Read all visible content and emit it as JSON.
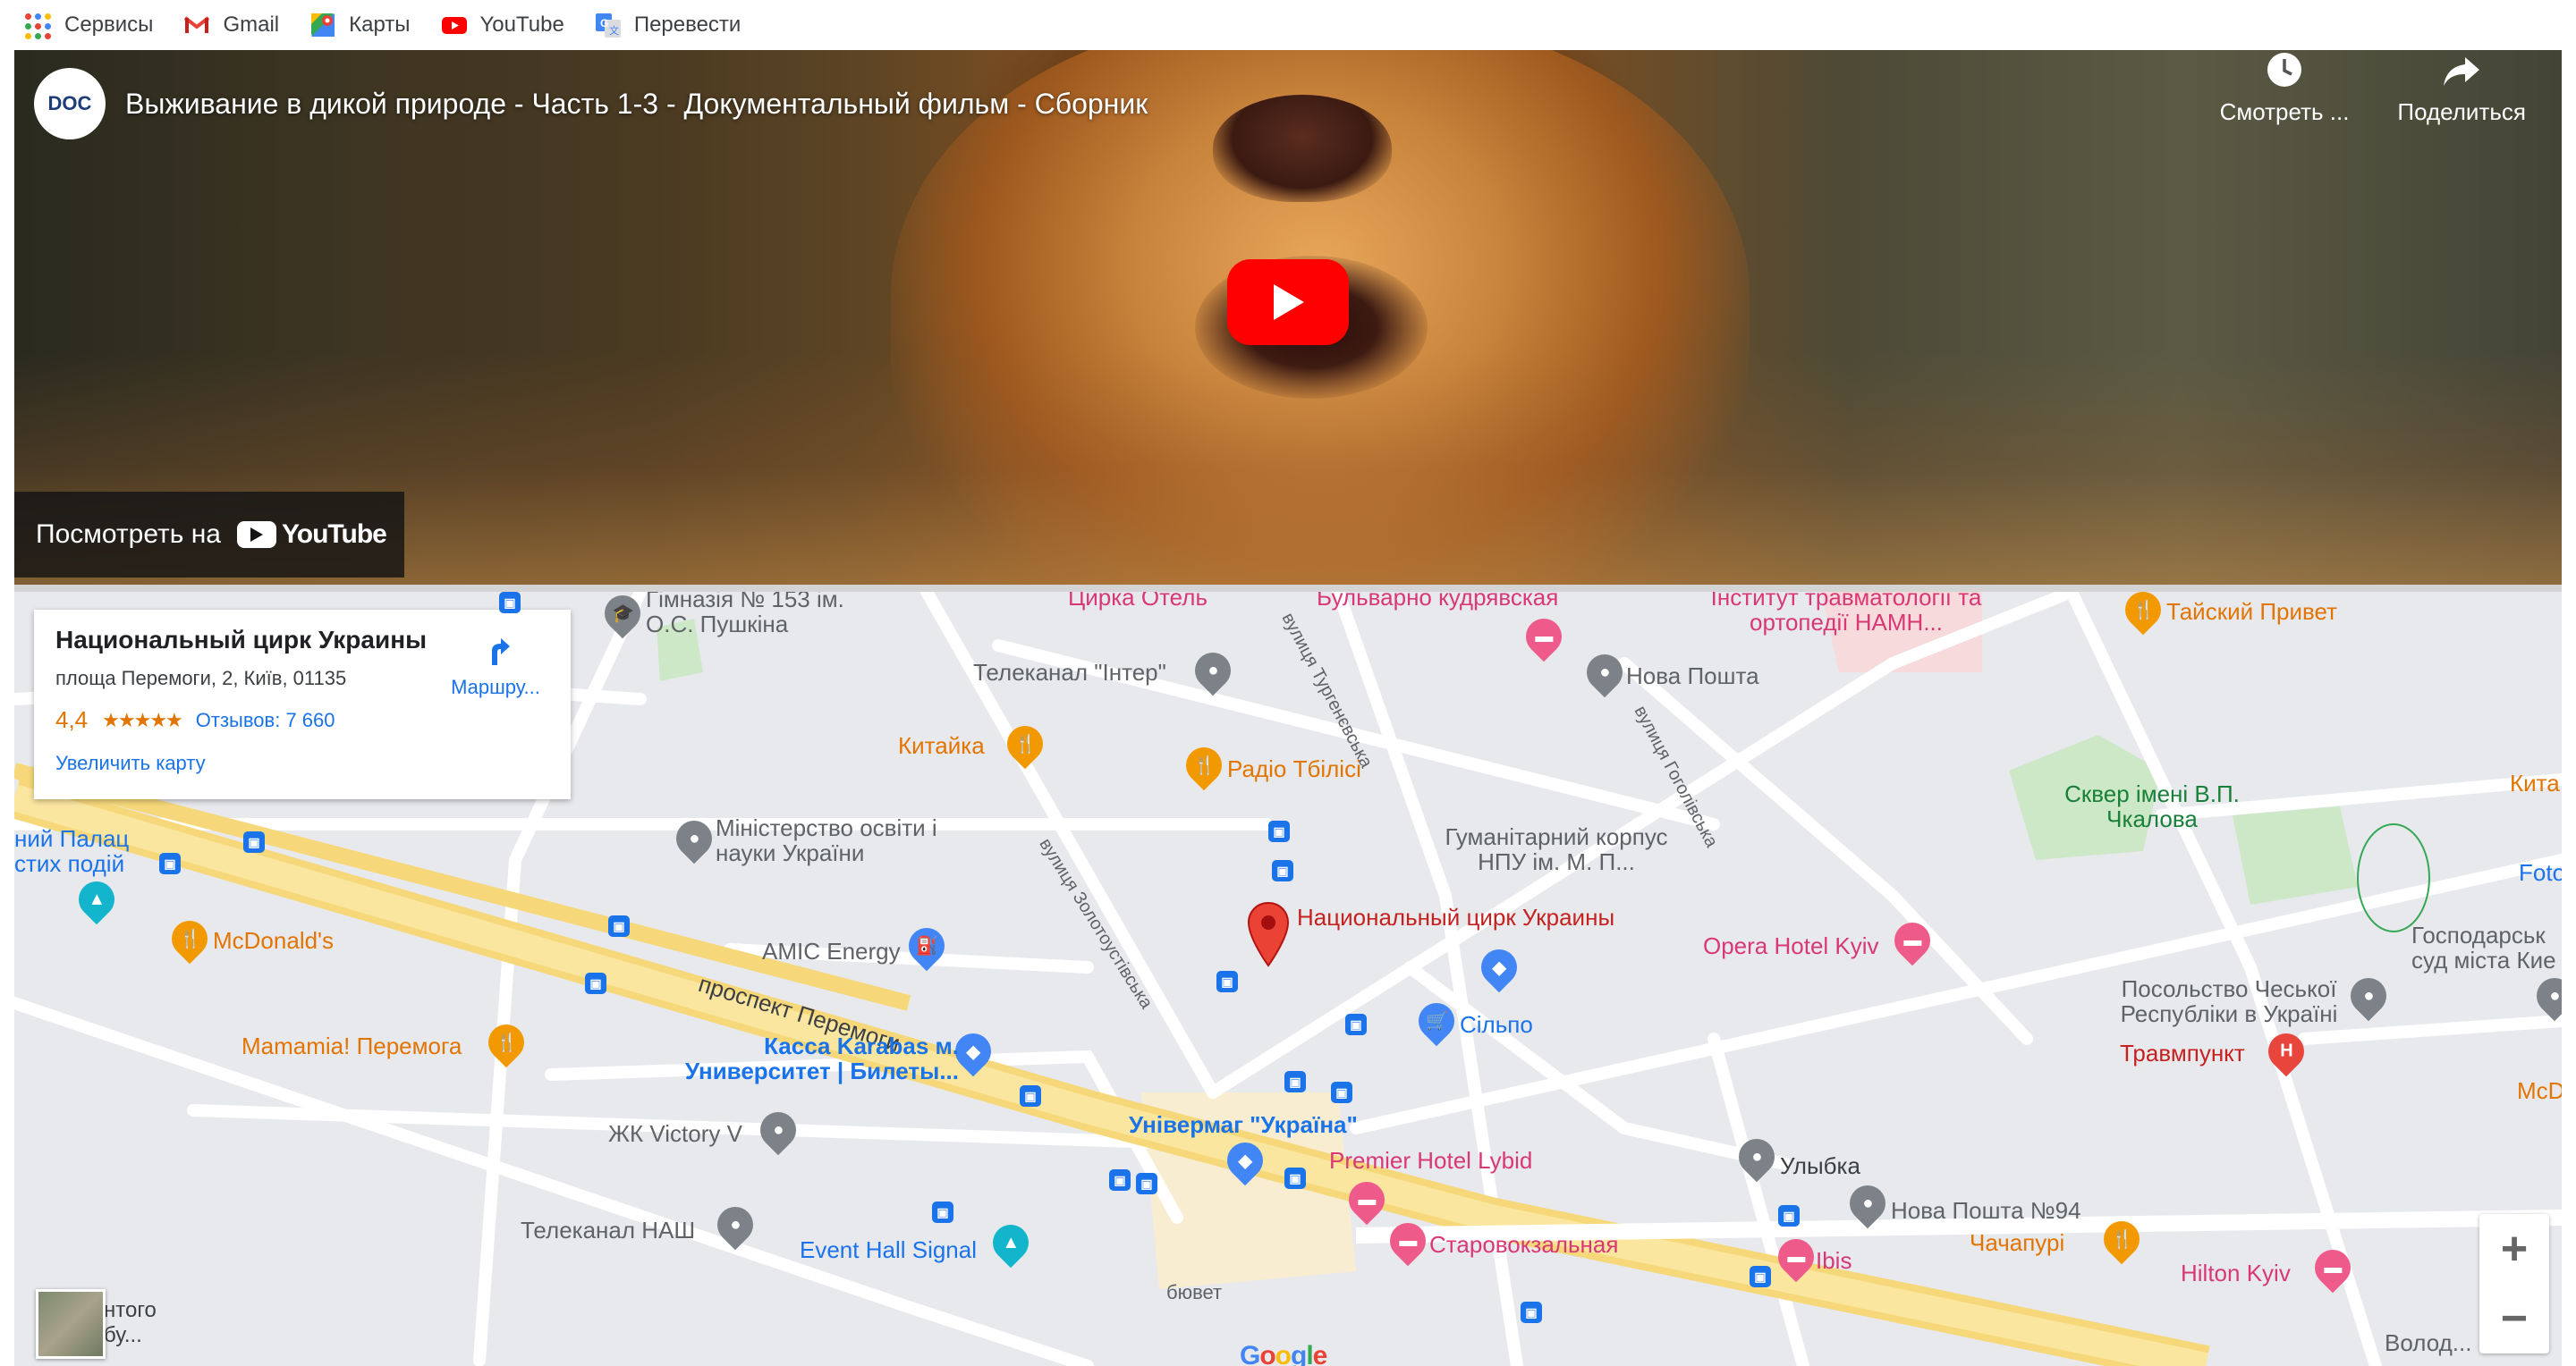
{
  "bookmarks": [
    {
      "label": "Сервисы",
      "icon": "apps-grid-icon"
    },
    {
      "label": "Gmail",
      "icon": "gmail-icon"
    },
    {
      "label": "Карты",
      "icon": "maps-icon"
    },
    {
      "label": "YouTube",
      "icon": "youtube-icon"
    },
    {
      "label": "Перевести",
      "icon": "translate-icon"
    }
  ],
  "video": {
    "channel_logo": "DOC",
    "title": "Выживание в дикой природе - Часть 1-3 - Документальный фильм - Сборник",
    "watch_later": "Смотреть ...",
    "share": "Поделиться",
    "watch_on": "Посмотреть на",
    "youtube_wordmark": "YouTube"
  },
  "map": {
    "card": {
      "title": "Национальный цирк Украины",
      "address": "площа Перемоги, 2, Київ, 01135",
      "rating": "4,4",
      "stars": "★★★★★",
      "reviews": "Отзывов: 7 660",
      "enlarge": "Увеличить карту",
      "directions": "Маршру..."
    },
    "main_place": "Национальный цирк Украины",
    "labels": {
      "gymnasium": "Гімназія № 153 ім. О.С. Пушкіна",
      "circus_hotel": "Цирка Отель",
      "bulvarno": "Бульварно кудрявская",
      "institute": "Інститут травматології та ортопедії НАМН...",
      "thai": "Тайский Привет",
      "inter": "Телеканал \"Інтер\"",
      "nova_poshta": "Нова Пошта",
      "kitaika": "Китайка",
      "radio": "Радіо Тбілісі",
      "skver": "Сквер імені В.П. Чкалова",
      "kita": "Кита",
      "palace": "ний Палац стих подій",
      "ministry": "Міністерство освіти і науки України",
      "humanitarian": "Гуманітарний корпус НПУ ім. М. П...",
      "foto": "Foto",
      "mcdonalds": "McDonald's",
      "amic": "AMIC Energy",
      "opera_hotel": "Opera Hotel Kyiv",
      "court": "Господарськ суд міста Кие",
      "embassy": "Посольство Чеської Республіки в Україні",
      "silpo": "Сільпо",
      "prospect": "проспект Перемоги",
      "mamamia": "Mamamia! Перемога",
      "karabas": "Касса Karabas м. Университет | Билеты...",
      "travmpunkt": "Травмпункт",
      "mcd_right": "McD",
      "victory": "ЖК Victory V",
      "univermag": "Універмаг \"Україна\"",
      "premier": "Premier Hotel Lybid",
      "ulybka": "Улыбка",
      "nova94": "Нова Пошта №94",
      "nash": "Телеканал НАШ",
      "event": "Event Hall Signal",
      "chachapuri": "Чачапурі",
      "starovokz": "Старовокзальная",
      "ibis": "Ibis",
      "hilton": "Hilton Kyiv",
      "volod": "Волод...",
      "buvet": "бювет",
      "left_bottom": "нтого бу...",
      "st_turgenev": "вулиця Тургенєвська",
      "st_gogol": "вулиця Гоголівська",
      "st_zolot": "вулиця Золотоустівська"
    },
    "zoom_in": "+",
    "zoom_out": "−",
    "google": "Google"
  },
  "colors": {
    "youtube_red": "#ff0000",
    "map_blue": "#1a73e8",
    "map_orange": "#e37400",
    "map_pink": "#d93877",
    "pin_red": "#e8453c"
  }
}
